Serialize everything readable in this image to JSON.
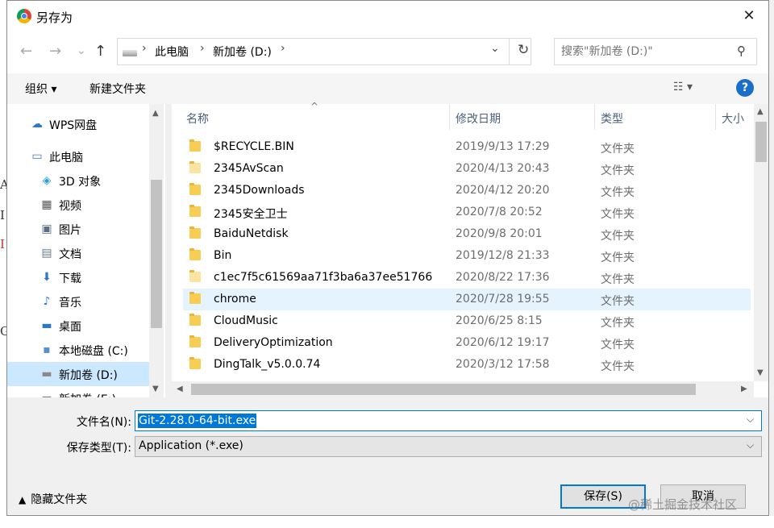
{
  "window": {
    "title": "另存为",
    "close_glyph": "✕"
  },
  "nav": {
    "back": "←",
    "forward": "→",
    "recent": "⌄",
    "up": "↑",
    "breadcrumb": [
      "此电脑",
      "新加卷 (D:)"
    ],
    "sep": "›",
    "dropdown": "⌄",
    "refresh": "↻",
    "search_placeholder": "搜索\"新加卷 (D:)\""
  },
  "toolbar": {
    "organize": "组织 ▾",
    "new_folder": "新建文件夹",
    "view": "☷  ▾",
    "help": "?"
  },
  "sidebar": {
    "items": [
      {
        "label": "WPS网盘",
        "icon": "cloud-icon",
        "glyph": "☁",
        "color": "#2b78c5"
      },
      {
        "label": "此电脑",
        "icon": "computer-icon",
        "glyph": "▭",
        "color": "#3a7bd5"
      },
      {
        "label": "3D 对象",
        "icon": "cube-icon",
        "glyph": "◈",
        "color": "#29a3d6"
      },
      {
        "label": "视频",
        "icon": "film-icon",
        "glyph": "▦",
        "color": "#555555"
      },
      {
        "label": "图片",
        "icon": "picture-icon",
        "glyph": "▣",
        "color": "#5a6e85"
      },
      {
        "label": "文档",
        "icon": "document-icon",
        "glyph": "▤",
        "color": "#6b7c92"
      },
      {
        "label": "下载",
        "icon": "download-icon",
        "glyph": "⬇",
        "color": "#2b78c5"
      },
      {
        "label": "音乐",
        "icon": "music-icon",
        "glyph": "♪",
        "color": "#2b78c5"
      },
      {
        "label": "桌面",
        "icon": "desktop-icon",
        "glyph": "▬",
        "color": "#2b78c5"
      },
      {
        "label": "本地磁盘 (C:)",
        "icon": "windows-drive-icon",
        "glyph": "▪",
        "color": "#5a8fd0"
      },
      {
        "label": "新加卷 (D:)",
        "icon": "drive-icon",
        "glyph": "▬",
        "color": "#8a8a8a"
      },
      {
        "label": "新加卷 (E:)",
        "icon": "drive-icon",
        "glyph": "▬",
        "color": "#8a8a8a"
      }
    ]
  },
  "columns": [
    "名称",
    "修改日期",
    "类型",
    "大小"
  ],
  "files": [
    {
      "name": "$RECYCLE.BIN",
      "date": "2019/9/13 17:29",
      "type": "文件夹"
    },
    {
      "name": "2345AvScan",
      "date": "2020/4/13 20:43",
      "type": "文件夹",
      "pale": true
    },
    {
      "name": "2345Downloads",
      "date": "2020/4/12 20:20",
      "type": "文件夹"
    },
    {
      "name": "2345安全卫士",
      "date": "2020/7/8 20:52",
      "type": "文件夹"
    },
    {
      "name": "BaiduNetdisk",
      "date": "2020/9/8 20:01",
      "type": "文件夹"
    },
    {
      "name": "Bin",
      "date": "2019/12/8 21:33",
      "type": "文件夹"
    },
    {
      "name": "c1ec7f5c61569aa71f3ba6a37ee51766",
      "date": "2020/8/22 17:36",
      "type": "文件夹",
      "pale": true
    },
    {
      "name": "chrome",
      "date": "2020/7/28 19:55",
      "type": "文件夹",
      "hover": true
    },
    {
      "name": "CloudMusic",
      "date": "2020/6/25 8:15",
      "type": "文件夹"
    },
    {
      "name": "DeliveryOptimization",
      "date": "2020/6/12 19:17",
      "type": "文件夹"
    },
    {
      "name": "DingTalk_v5.0.0.74",
      "date": "2020/3/12 17:58",
      "type": "文件夹"
    }
  ],
  "form": {
    "filename_label": "文件名(N):",
    "filename_value": "Git-2.28.0-64-bit.exe",
    "filetype_label": "保存类型(T):",
    "filetype_value": "Application (*.exe)",
    "hide_folders": "隐藏文件夹",
    "save": "保存(S)",
    "cancel": "取消"
  },
  "watermark": "@稀土掘金技术社区",
  "bg_letters": [
    "A",
    "I",
    "I",
    "G"
  ]
}
